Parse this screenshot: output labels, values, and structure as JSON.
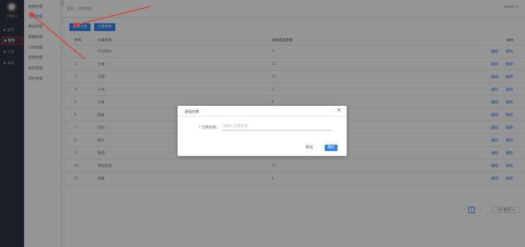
{
  "user": {
    "name": "已登录 ▾"
  },
  "rail": [
    {
      "label": "首页",
      "icon": "home-icon"
    },
    {
      "label": "菜单",
      "icon": "menu-icon",
      "active": true
    },
    {
      "label": "订单",
      "icon": "order-icon"
    },
    {
      "label": "系统",
      "icon": "gear-icon"
    }
  ],
  "subnav": [
    {
      "label": "用餐管理"
    },
    {
      "label": "分类管理",
      "active": true
    },
    {
      "label": "菜品管理"
    },
    {
      "label": "套餐管理"
    },
    {
      "label": "口味管理"
    },
    {
      "label": "规格管理"
    },
    {
      "label": "会员管理"
    },
    {
      "label": "评价管理"
    }
  ],
  "breadcrumb": "首页 / 分类管理",
  "topbar_right": "admin ▾",
  "toolbar": {
    "add_label": "新增分类",
    "sort_label": "分类排序"
  },
  "table": {
    "headers": {
      "idx": "序号",
      "name": "分类名称",
      "count": "关联商品数量",
      "ops": "操作"
    },
    "edit_label": "编辑",
    "delete_label": "删除",
    "rows": [
      {
        "idx": "1",
        "name": "今日特价",
        "count": "7"
      },
      {
        "idx": "2",
        "name": "主食",
        "count": "12"
      },
      {
        "idx": "3",
        "name": "凉菜",
        "count": "11"
      },
      {
        "idx": "4",
        "name": "小吃",
        "count": "2"
      },
      {
        "idx": "5",
        "name": "主食",
        "count": "4"
      },
      {
        "idx": "6",
        "name": "面食",
        "count": ""
      },
      {
        "idx": "7",
        "name": "饮料",
        "count": ""
      },
      {
        "idx": "8",
        "name": "酒水",
        "count": ""
      },
      {
        "idx": "9",
        "name": "甜品",
        "count": ""
      },
      {
        "idx": "10",
        "name": "特色菜品",
        "count": "12"
      },
      {
        "idx": "11",
        "name": "套餐",
        "count": "1"
      }
    ]
  },
  "pager": {
    "prev": "‹",
    "current": "1",
    "next": "›",
    "size": "10 条/页 ▾"
  },
  "dialog": {
    "title": "添加分类",
    "close": "×",
    "label": "* 分类名称:",
    "placeholder": "请输入分类名称",
    "value": "",
    "cancel": "取消",
    "ok": "确定"
  },
  "colors": {
    "accent": "#2f7fe6",
    "annotation": "#e0392b",
    "rail": "#2c313a"
  }
}
